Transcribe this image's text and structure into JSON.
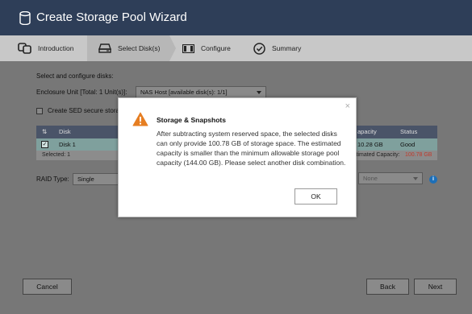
{
  "window": {
    "title": "Create Storage Pool Wizard",
    "icon": "database-icon"
  },
  "steps": [
    {
      "label": "Introduction",
      "icon": "storage-pool-icon",
      "active": false
    },
    {
      "label": "Select Disk(s)",
      "icon": "disk-drive-icon",
      "active": true
    },
    {
      "label": "Configure",
      "icon": "configure-icon",
      "active": false
    },
    {
      "label": "Summary",
      "icon": "check-circle-icon",
      "active": false
    }
  ],
  "main": {
    "section_label": "Select and configure disks:",
    "enclosure_label": "Enclosure Unit [Total: 1 Unit(s)]:",
    "enclosure_value": "NAS Host [available disk(s): 1/1]",
    "sed_label": "Create SED secure stora",
    "table": {
      "headers": {
        "select": "",
        "disk": "Disk",
        "capacity": "apacity",
        "status": "Status"
      },
      "rows": [
        {
          "disk": "Disk 1",
          "capacity": "10.28 GB",
          "status": "Good",
          "checked": true
        }
      ],
      "footer_selected": "Selected: 1",
      "footer_capacity_label": "stimated Capacity:",
      "footer_capacity_value": "100.78 GB"
    },
    "raid_label": "RAID Type:",
    "raid_value": "Single",
    "hot_spare_value": "None"
  },
  "footer": {
    "cancel": "Cancel",
    "back": "Back",
    "next": "Next"
  },
  "dialog": {
    "title": "Storage & Snapshots",
    "message": "After subtracting system reserved space, the selected disks can only provide 100.78 GB of storage space. The estimated capacity is smaller than the minimum allowable storage pool capacity (144.00 GB). Please select another disk combination.",
    "ok_label": "OK",
    "close_glyph": "×"
  },
  "colors": {
    "accent_red": "#c0392b",
    "warning_orange": "#e67e22",
    "title_bar": "#2e3e58",
    "selected_row": "#7fa09d"
  }
}
